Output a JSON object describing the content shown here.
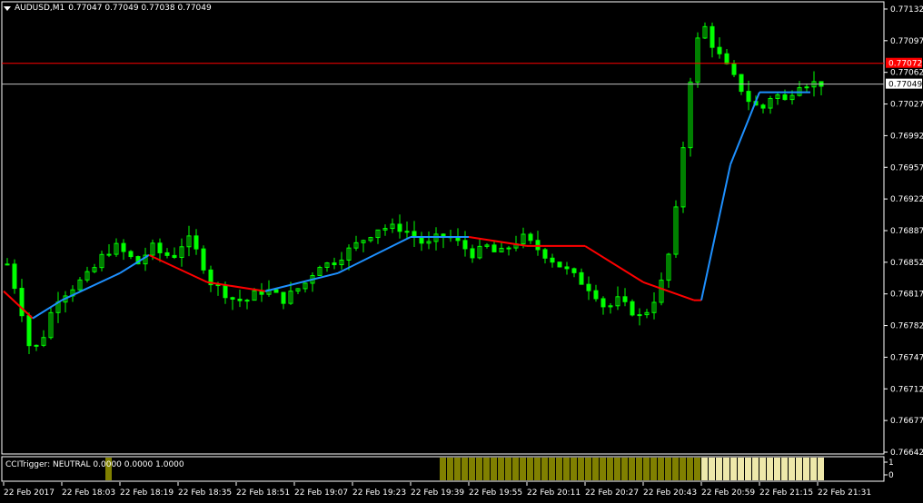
{
  "header": {
    "symbol": "AUDUSD,M1",
    "ohlc": "0.77047 0.77049 0.77038 0.77049"
  },
  "indicator": {
    "label": "CCITrigger: NEUTRAL 0.0000 0.0000 1.0000",
    "scale_labels": [
      "1",
      "0"
    ]
  },
  "colors": {
    "background": "#000000",
    "axis": "#ffffff",
    "candle": "#00ff00",
    "trend_up": "#1e90ff",
    "trend_down": "#ff0000",
    "bid_line": "#c0c0c0",
    "ask_line": "#ff0000",
    "hist_dark": "#808000",
    "hist_light": "#eee8aa"
  },
  "price_axis": {
    "labels": [
      "0.77132",
      "0.77097",
      "0.77062",
      "0.77027",
      "0.76992",
      "0.76957",
      "0.76922",
      "0.76887",
      "0.76852",
      "0.76817",
      "0.76782",
      "0.76747",
      "0.76712",
      "0.76677",
      "0.76642"
    ],
    "min": 0.7664,
    "max": 0.7714
  },
  "price_tags": {
    "ask": {
      "value": 0.77072,
      "label": "0.77072"
    },
    "bid": {
      "value": 0.77049,
      "label": "0.77049"
    }
  },
  "time_axis": {
    "labels": [
      "22 Feb 2017",
      "22 Feb 18:03",
      "22 Feb 18:19",
      "22 Feb 18:35",
      "22 Feb 18:51",
      "22 Feb 19:07",
      "22 Feb 19:23",
      "22 Feb 19:39",
      "22 Feb 19:55",
      "22 Feb 20:11",
      "22 Feb 20:27",
      "22 Feb 20:43",
      "22 Feb 20:59",
      "22 Feb 21:15",
      "22 Feb 21:31"
    ]
  },
  "chart_data": {
    "type": "line",
    "title": "AUDUSD,M1",
    "ylim": [
      0.7664,
      0.7714
    ],
    "x_labels": [
      "22 Feb 2017",
      "22 Feb 18:03",
      "22 Feb 18:19",
      "22 Feb 18:35",
      "22 Feb 18:51",
      "22 Feb 19:07",
      "22 Feb 19:23",
      "22 Feb 19:39",
      "22 Feb 19:55",
      "22 Feb 20:11",
      "22 Feb 20:27",
      "22 Feb 20:43",
      "22 Feb 20:59",
      "22 Feb 21:15",
      "22 Feb 21:31"
    ],
    "price_anchors": [
      0.7685,
      0.7681,
      0.7675,
      0.7677,
      0.7681,
      0.7682,
      0.7683,
      0.7684,
      0.7686,
      0.7687,
      0.7686,
      0.7685,
      0.7687,
      0.7686,
      0.7686,
      0.7688,
      0.7686,
      0.7683,
      0.7682,
      0.7681,
      0.7681,
      0.7682,
      0.7682,
      0.7681,
      0.7682,
      0.7683,
      0.7685,
      0.7685,
      0.7686,
      0.7687,
      0.7688,
      0.7689,
      0.7689,
      0.7689,
      0.7688,
      0.7687,
      0.7688,
      0.7688,
      0.7687,
      0.7686,
      0.7687,
      0.7686,
      0.7687,
      0.7688,
      0.7687,
      0.7686,
      0.7685,
      0.7684,
      0.7683,
      0.7682,
      0.768,
      0.7681,
      0.768,
      0.7679,
      0.7681,
      0.7684,
      0.7692,
      0.7705,
      0.7712,
      0.7709,
      0.7707,
      0.7705,
      0.7703,
      0.7702,
      0.7704,
      0.7703,
      0.7705,
      0.7705,
      0.7705
    ],
    "trend_anchors": [
      {
        "bar": 0,
        "value": 0.7682,
        "color": "down"
      },
      {
        "bar": 4,
        "value": 0.7679,
        "color": "up"
      },
      {
        "bar": 8,
        "value": 0.7681,
        "color": "up"
      },
      {
        "bar": 16,
        "value": 0.7684,
        "color": "up"
      },
      {
        "bar": 20,
        "value": 0.7686,
        "color": "down"
      },
      {
        "bar": 28,
        "value": 0.7683,
        "color": "down"
      },
      {
        "bar": 36,
        "value": 0.7682,
        "color": "up"
      },
      {
        "bar": 46,
        "value": 0.7684,
        "color": "up"
      },
      {
        "bar": 56,
        "value": 0.7688,
        "color": "up"
      },
      {
        "bar": 64,
        "value": 0.7688,
        "color": "down"
      },
      {
        "bar": 72,
        "value": 0.7687,
        "color": "down"
      },
      {
        "bar": 80,
        "value": 0.7687,
        "color": "down"
      },
      {
        "bar": 88,
        "value": 0.7683,
        "color": "down"
      },
      {
        "bar": 95,
        "value": 0.7681,
        "color": "down"
      },
      {
        "bar": 96,
        "value": 0.7681,
        "color": "up"
      },
      {
        "bar": 100,
        "value": 0.7696,
        "color": "up"
      },
      {
        "bar": 104,
        "value": 0.7704,
        "color": "up"
      },
      {
        "bar": 111,
        "value": 0.7704,
        "color": "up"
      }
    ],
    "histogram": [
      {
        "from_bar": 14,
        "to_bar": 14,
        "shade": "dark"
      },
      {
        "from_bar": 60,
        "to_bar": 96,
        "shade": "dark"
      },
      {
        "from_bar": 96,
        "to_bar": 112,
        "shade": "light"
      }
    ]
  }
}
